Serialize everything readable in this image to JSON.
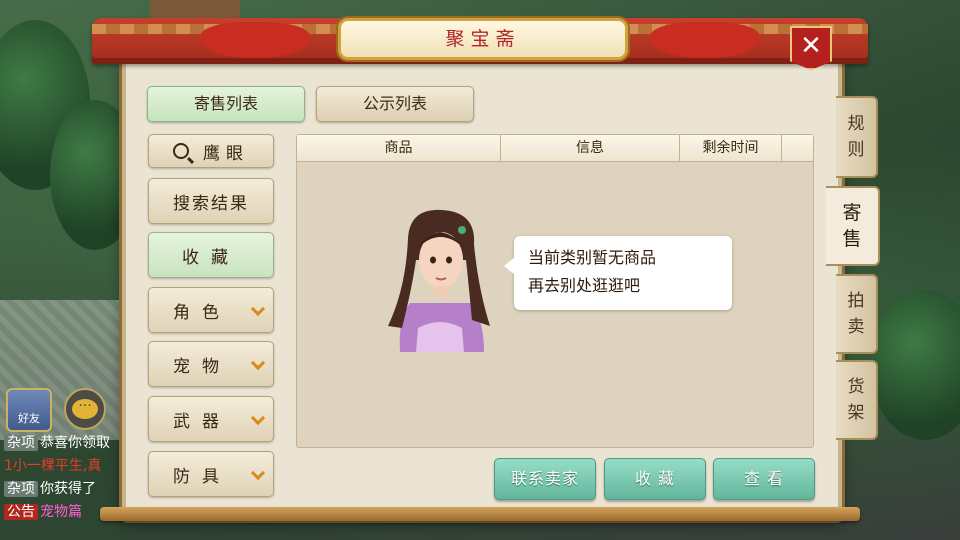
{
  "window": {
    "title": "聚宝斋",
    "close_label": "✕"
  },
  "top_tabs": [
    {
      "label": "寄售列表",
      "active": true
    },
    {
      "label": "公示列表",
      "active": false
    }
  ],
  "sidebar": {
    "search_label": "鹰眼",
    "items": [
      {
        "label": "搜索结果"
      },
      {
        "label": "收藏"
      },
      {
        "label": "角色"
      },
      {
        "label": "宠物"
      },
      {
        "label": "武器"
      },
      {
        "label": "防具"
      }
    ]
  },
  "table": {
    "columns": [
      "商品",
      "信息",
      "剩余时间"
    ],
    "empty_message_line1": "当前类别暂无商品",
    "empty_message_line2": "再去别处逛逛吧"
  },
  "actions": {
    "contact_seller": "联系卖家",
    "favorite": "收 藏",
    "view": "查 看"
  },
  "right_tabs": [
    {
      "label": "规\n则",
      "active": false
    },
    {
      "label": "寄\n售",
      "active": true
    },
    {
      "label": "拍\n卖",
      "active": false
    },
    {
      "label": "货\n架",
      "active": false
    }
  ],
  "chat": {
    "friend_icon_label": "好友",
    "messages": [
      {
        "channel": "杂项",
        "text": "恭喜你领取"
      },
      {
        "channel": "",
        "text": "1小一棵平生,真"
      },
      {
        "channel": "杂项",
        "text": "你获得了"
      },
      {
        "channel": "公告",
        "text": "宠物篇"
      }
    ]
  },
  "colors": {
    "accent_green": "#62b69c",
    "title_red": "#b2262a",
    "roof_red": "#c7402c",
    "panel_bg": "#ece4d3"
  }
}
